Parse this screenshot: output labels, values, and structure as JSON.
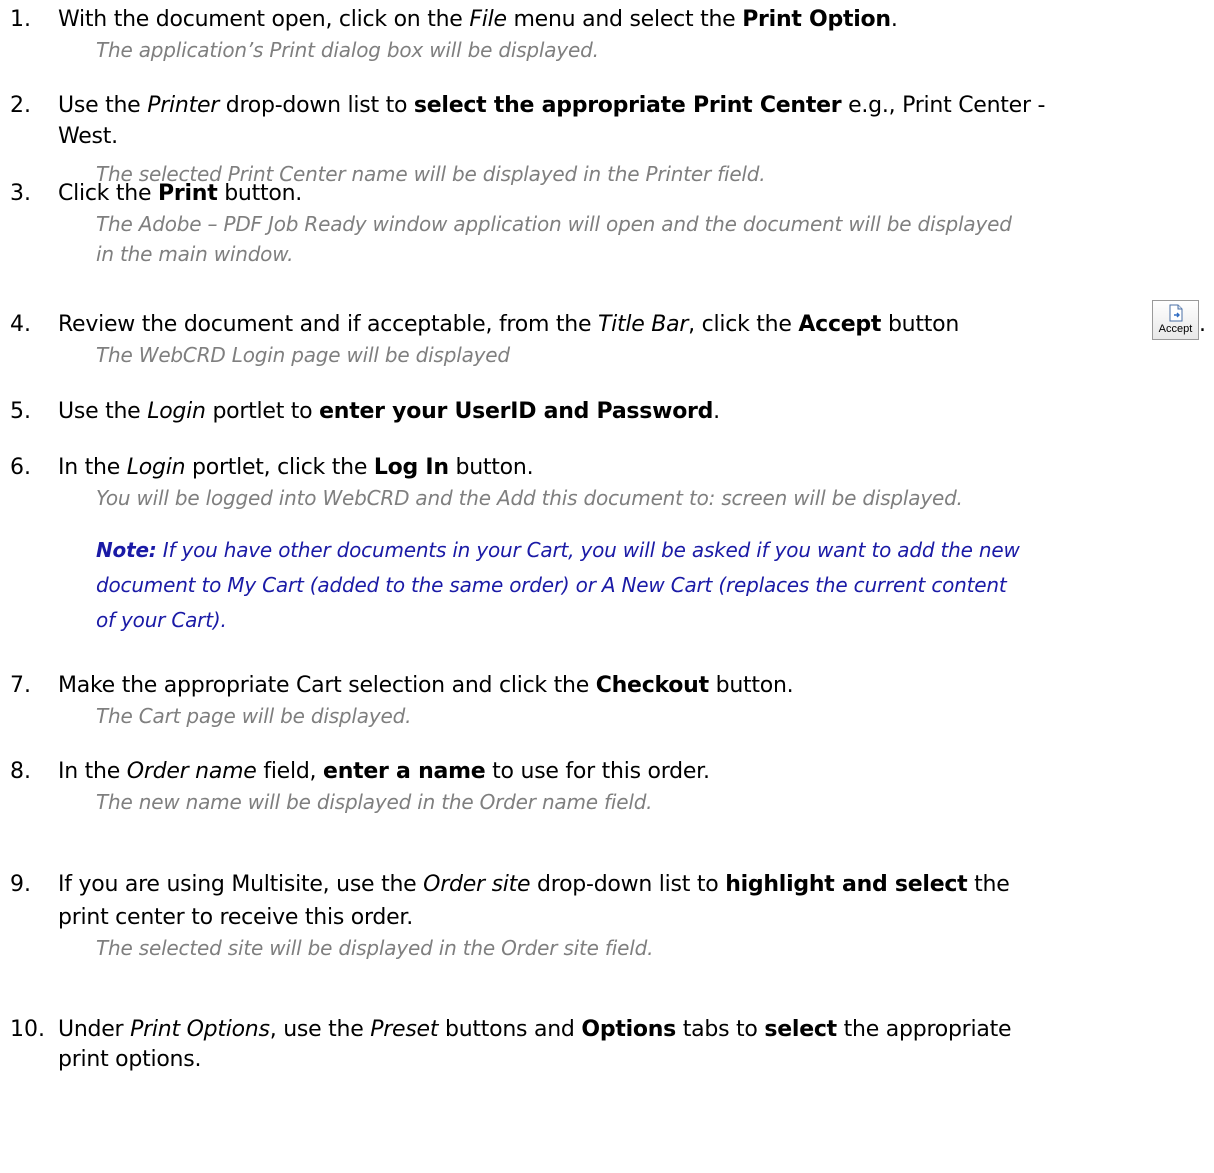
{
  "steps": [
    {
      "num": "1.",
      "parts": [
        {
          "t": "With the document open, click on the "
        },
        {
          "t": "File",
          "s": "i"
        },
        {
          "t": " menu and select the "
        },
        {
          "t": "Print Option",
          "s": "b"
        },
        {
          "t": "."
        }
      ],
      "result": "The application’s Print dialog box will be displayed."
    },
    {
      "num": "2.",
      "parts": [
        {
          "t": "Use the "
        },
        {
          "t": "Printer",
          "s": "i"
        },
        {
          "t": " drop-down list to "
        },
        {
          "t": "select the appropriate Print Center",
          "s": "b"
        },
        {
          "t": " e.g., Print Center -"
        }
      ],
      "cont": "West.",
      "result": "The selected Print Center name will be displayed in the Printer field."
    },
    {
      "num": "3.",
      "parts": [
        {
          "t": "Click the "
        },
        {
          "t": "Print",
          "s": "b"
        },
        {
          "t": " button."
        }
      ],
      "result": "The Adobe – PDF Job Ready window application will open and the document will be displayed",
      "result2": "in the main window."
    },
    {
      "num": "4.",
      "parts": [
        {
          "t": "Review the document and if acceptable, from the "
        },
        {
          "t": "Title Bar",
          "s": "i"
        },
        {
          "t": ", click the "
        },
        {
          "t": "Accept",
          "s": "b"
        },
        {
          "t": " button"
        }
      ],
      "trail": ".",
      "accept_icon_label": "Accept",
      "result": "The WebCRD Login page will be displayed"
    },
    {
      "num": "5.",
      "parts": [
        {
          "t": "Use the "
        },
        {
          "t": "Login",
          "s": "i"
        },
        {
          "t": " portlet to "
        },
        {
          "t": "enter your UserID and Password",
          "s": "b"
        },
        {
          "t": "."
        }
      ]
    },
    {
      "num": "6.",
      "parts": [
        {
          "t": "In the "
        },
        {
          "t": "Login",
          "s": "i"
        },
        {
          "t": " portlet, click the "
        },
        {
          "t": "Log In",
          "s": "b"
        },
        {
          "t": " button."
        }
      ],
      "result": "You will be logged into WebCRD and the Add this document to: screen will be displayed.",
      "note_label": "Note:",
      "note_lines": [
        " If you have other documents in your Cart, you will be asked if you want to add the new",
        "document to My Cart (added to the same order) or A New Cart (replaces the current content",
        "of your Cart)."
      ]
    },
    {
      "num": "7.",
      "parts": [
        {
          "t": "Make the appropriate Cart selection and click the "
        },
        {
          "t": "Checkout",
          "s": "b"
        },
        {
          "t": " button."
        }
      ],
      "result": "The Cart page will be displayed."
    },
    {
      "num": "8.",
      "parts": [
        {
          "t": "In the "
        },
        {
          "t": "Order name",
          "s": "i"
        },
        {
          "t": " field, "
        },
        {
          "t": "enter a name",
          "s": "b"
        },
        {
          "t": " to use for this order."
        }
      ],
      "result": "The new name will be displayed in the Order name field."
    },
    {
      "num": "9.",
      "parts": [
        {
          "t": "If you are using Multisite, use the "
        },
        {
          "t": "Order site",
          "s": "i"
        },
        {
          "t": " drop-down list to "
        },
        {
          "t": "highlight and select",
          "s": "b"
        },
        {
          "t": " the"
        }
      ],
      "cont": "print center to receive this order.",
      "result": "The selected site will be displayed in the Order site field."
    },
    {
      "num": "10.",
      "parts": [
        {
          "t": "Under "
        },
        {
          "t": "Print Options",
          "s": "i"
        },
        {
          "t": ", use the "
        },
        {
          "t": "Preset",
          "s": "i"
        },
        {
          "t": " buttons and "
        },
        {
          "t": "Options",
          "s": "b"
        },
        {
          "t": " tabs to "
        },
        {
          "t": "select",
          "s": "b"
        },
        {
          "t": " the appropriate"
        }
      ],
      "cont": "print options."
    }
  ]
}
